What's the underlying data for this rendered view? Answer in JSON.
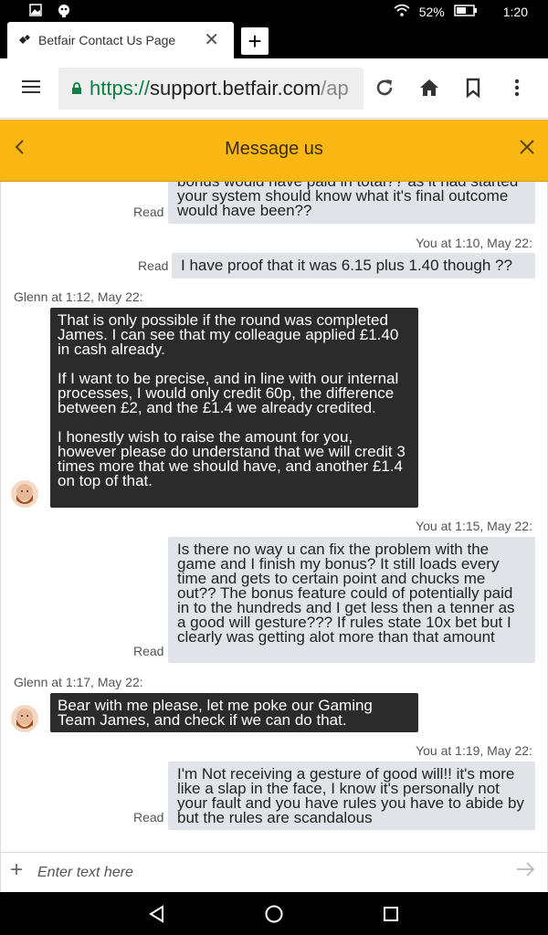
{
  "status_bar": {
    "battery": "52%",
    "time": "1:20"
  },
  "browser": {
    "tab_title": "Betfair Contact Us Page",
    "url_scheme": "https://",
    "url_host": "support.betfair.com",
    "url_path": "/ap"
  },
  "chat": {
    "header_title": "Message us",
    "messages": [
      {
        "text": "bonus would have paid in total?? as it had started your system should know what it's final outcome would have been??",
        "status": "Read"
      },
      {
        "meta": "You at 1:10, May 22:",
        "text": "I have proof that it was 6.15 plus 1.40 though ??",
        "status": "Read"
      },
      {
        "meta": "Glenn at 1:12, May 22:",
        "paragraphs": [
          "That is only possible if the round was completed James. I can see that my colleague applied £1.40 in cash already.",
          "If I want to be precise, and in line with our internal processes, I would only credit 60p, the difference between £2, and the £1.4 we already credited.",
          "I honestly wish to raise the amount for you, however please do understand that we will credit 3 times more that we should have, and another £1.4 on top of that."
        ]
      },
      {
        "meta": "You at 1:15, May 22:",
        "text": "Is there no way u can fix the problem with the game and I finish my bonus? It still loads every time and gets to certain point and chucks me out?? The bonus feature could of potentially paid in to the hundreds and I get less then a tenner as a good will gesture??? If rules state 10x bet but I clearly was getting alot more than that amount",
        "status": "Read"
      },
      {
        "meta": "Glenn at 1:17, May 22:",
        "text": "Bear with me please, let me poke our Gaming Team James, and check if we can do that."
      },
      {
        "meta": "You at 1:19, May 22:",
        "text": "I'm Not receiving a gesture of good will!! it's more like a slap in the face, I know it's personally not your fault and you have rules you have to abide by but the rules are scandalous",
        "status": "Read"
      }
    ],
    "input_placeholder": "Enter text here"
  },
  "colors": {
    "header_bg": "#fbb714",
    "agent_bubble": "#2b2b2b",
    "user_bubble": "#e0e4e8",
    "url_green": "#0a8043"
  }
}
